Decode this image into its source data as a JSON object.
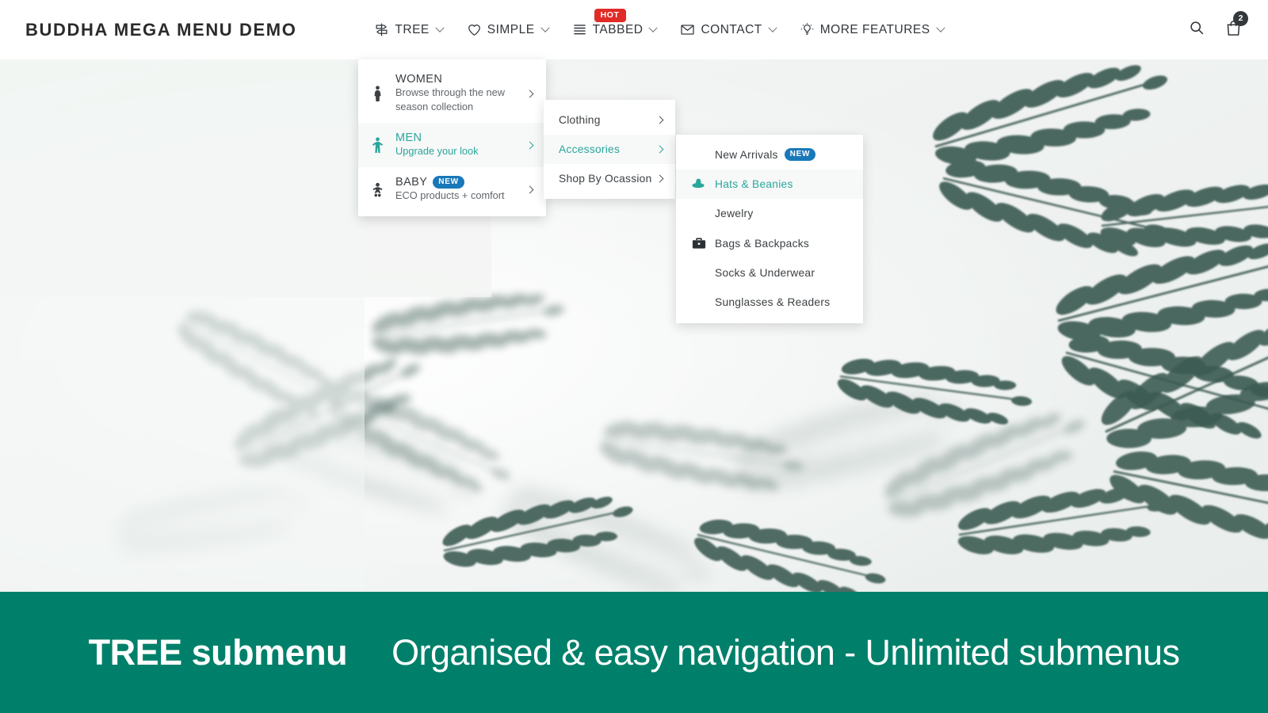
{
  "header": {
    "brand": "BUDDHA MEGA MENU DEMO",
    "nav": [
      {
        "label": "TREE",
        "icon": "signpost-icon",
        "caret": true,
        "badge": null,
        "active": true
      },
      {
        "label": "SIMPLE",
        "icon": "heart-icon",
        "caret": true,
        "badge": null,
        "active": false
      },
      {
        "label": "TABBED",
        "icon": "stack-lines-icon",
        "caret": true,
        "badge": "HOT",
        "active": false
      },
      {
        "label": "CONTACT",
        "icon": "envelope-icon",
        "caret": true,
        "badge": null,
        "active": false
      },
      {
        "label": "MORE FEATURES",
        "icon": "lightbulb-icon",
        "caret": true,
        "badge": null,
        "active": false
      }
    ],
    "search_icon": "search-icon",
    "cart_icon": "shopping-bag-icon",
    "cart_count": "2"
  },
  "menu_level1": [
    {
      "title": "WOMEN",
      "desc": "Browse through the new season collection",
      "icon": "woman-figure-icon",
      "badge": null,
      "active": false
    },
    {
      "title": "MEN",
      "desc": "Upgrade your look",
      "icon": "man-figure-icon",
      "badge": null,
      "active": true
    },
    {
      "title": "BABY",
      "desc": "ECO products + comfort",
      "icon": "baby-figure-icon",
      "badge": "NEW",
      "active": false
    }
  ],
  "menu_level2": [
    {
      "label": "Clothing",
      "active": false
    },
    {
      "label": "Accessories",
      "active": true
    },
    {
      "label": "Shop By Ocassion",
      "active": false
    }
  ],
  "menu_level3": [
    {
      "label": "New Arrivals",
      "badge": "NEW",
      "icon": null,
      "active": false
    },
    {
      "label": "Hats & Beanies",
      "badge": null,
      "icon": "hat-icon",
      "active": true
    },
    {
      "label": "Jewelry",
      "badge": null,
      "icon": null,
      "active": false
    },
    {
      "label": "Bags & Backpacks",
      "badge": null,
      "icon": "briefcase-icon",
      "active": false
    },
    {
      "label": "Socks & Underwear",
      "badge": null,
      "icon": null,
      "active": false
    },
    {
      "label": "Sunglasses & Readers",
      "badge": null,
      "icon": null,
      "active": false
    }
  ],
  "banner": {
    "title": "TREE submenu",
    "subtitle": "Organised & easy navigation - Unlimited submenus"
  },
  "colors": {
    "accent_teal": "#2aa79b",
    "banner_green": "#00806a",
    "badge_red": "#e02b27",
    "badge_blue": "#1878b9",
    "text_dark": "#3c4043"
  }
}
